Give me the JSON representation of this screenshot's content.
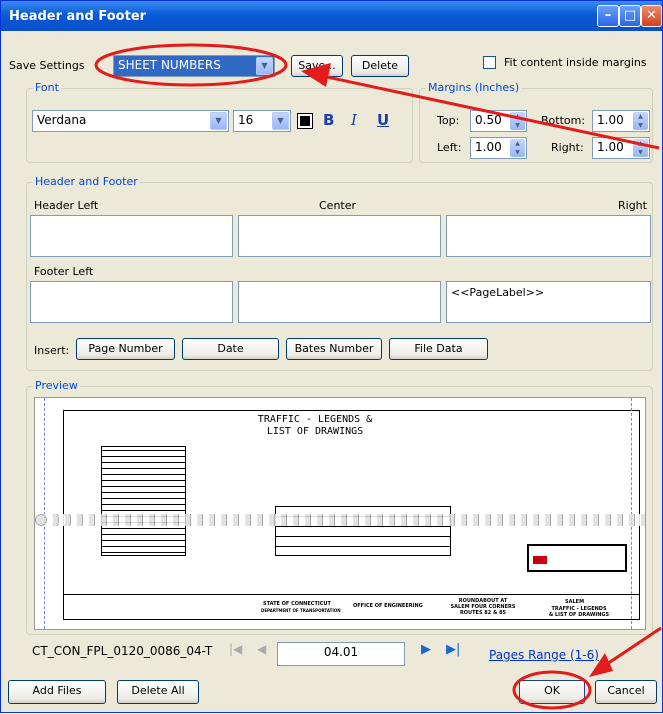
{
  "window": {
    "title": "Header and Footer"
  },
  "save_settings": {
    "label": "Save Settings",
    "selected": "SHEET NUMBERS",
    "save_button": "Save...",
    "delete_button": "Delete"
  },
  "fit_content": {
    "label": "Fit content inside margins",
    "checked": false
  },
  "font": {
    "group_label": "Font",
    "family": "Verdana",
    "size": "16",
    "bold": "B",
    "italic": "I",
    "underline": "U"
  },
  "margins": {
    "group_label": "Margins (Inches)",
    "top_label": "Top:",
    "top": "0.50",
    "bottom_label": "Bottom:",
    "bottom": "1.00",
    "left_label": "Left:",
    "left": "1.00",
    "right_label": "Right:",
    "right": "1.00"
  },
  "header_footer": {
    "group_label": "Header and Footer",
    "header_left_label": "Header Left",
    "center_label": "Center",
    "right_label": "Right",
    "footer_left_label": "Footer Left",
    "footer_right_value": "<<PageLabel>>",
    "insert_label": "Insert:",
    "insert_buttons": [
      "Page Number",
      "Date",
      "Bates Number",
      "File Data"
    ]
  },
  "preview": {
    "group_label": "Preview",
    "drawing_title_1": "TRAFFIC - LEGENDS &",
    "drawing_title_2": "LIST OF DRAWINGS",
    "tb_state": "STATE OF CONNECTICUT",
    "tb_dept": "DEPARTMENT OF TRANSPORTATION",
    "tb_office": "OFFICE OF ENGINEERING",
    "tb_project_1": "ROUNDABOUT AT",
    "tb_project_2": "SALEM FOUR CORNERS",
    "tb_project_3": "ROUTES 82 & 85",
    "tb_town": "SALEM",
    "tb_sheet_1": "TRAFFIC - LEGENDS",
    "tb_sheet_2": "& LIST OF DRAWINGS"
  },
  "navigation": {
    "filename": "CT_CON_FPL_0120_0086_04-T",
    "page_value": "04.01",
    "pages_range": "Pages Range (1-6)"
  },
  "footer_buttons": {
    "add_files": "Add Files",
    "delete_all": "Delete All",
    "ok": "OK",
    "cancel": "Cancel"
  },
  "annotation_color": "#e21b1b"
}
